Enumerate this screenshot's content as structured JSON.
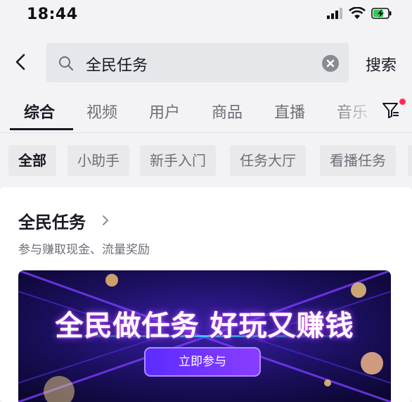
{
  "status_bar": {
    "time": "18:44"
  },
  "search": {
    "back_label": "<",
    "query": "全民任务",
    "submit_label": "搜索"
  },
  "tabs": [
    {
      "label": "综合"
    },
    {
      "label": "视频"
    },
    {
      "label": "用户"
    },
    {
      "label": "商品"
    },
    {
      "label": "直播"
    },
    {
      "label": "音乐"
    }
  ],
  "chips": [
    {
      "label": "全部"
    },
    {
      "label": "小助手"
    },
    {
      "label": "新手入门"
    },
    {
      "label": "任务大厅"
    },
    {
      "label": "看播任务"
    }
  ],
  "card": {
    "title": "全民任务",
    "subtitle": "参与赚取现金、流量奖励",
    "banner": {
      "headline": "全民做任务 好玩又赚钱",
      "button_label": "立即参与"
    }
  }
}
